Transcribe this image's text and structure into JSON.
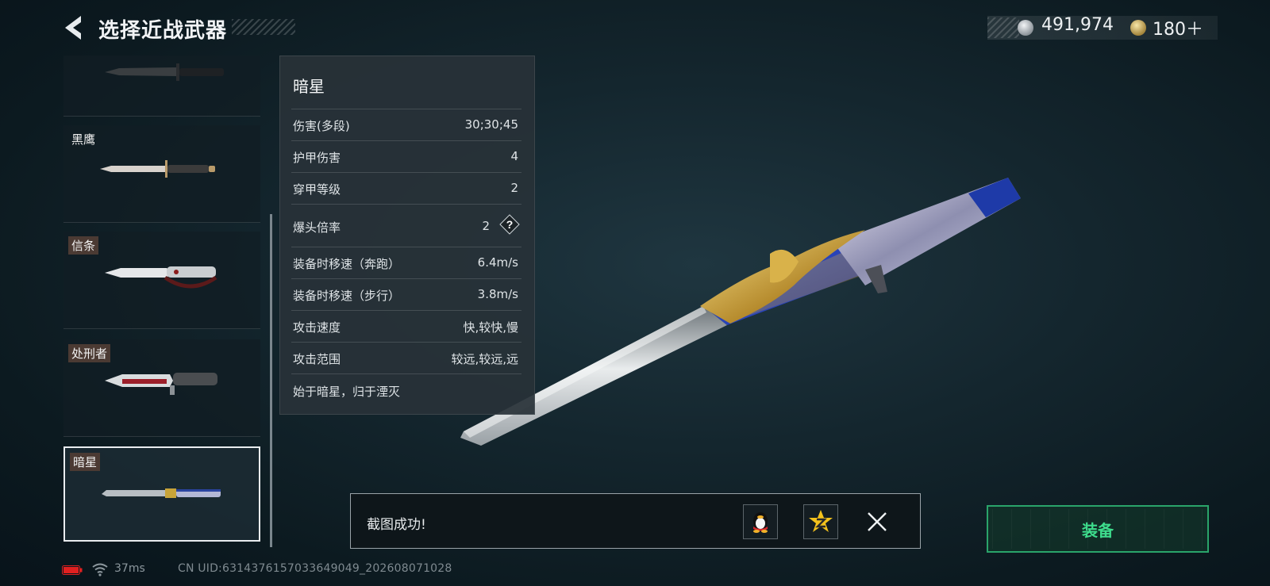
{
  "header": {
    "title": "选择近战武器"
  },
  "currency": {
    "silver": "491,974",
    "gold": "180＋"
  },
  "weapon_list": [
    {
      "label": ""
    },
    {
      "label": "黑鹰"
    },
    {
      "label": "信条"
    },
    {
      "label": "处刑者"
    },
    {
      "label": "暗星"
    }
  ],
  "stats": {
    "name": "暗星",
    "rows": [
      {
        "key": "伤害(多段)",
        "value": "30;30;45"
      },
      {
        "key": "护甲伤害",
        "value": "4"
      },
      {
        "key": "穿甲等级",
        "value": "2"
      },
      {
        "key": "爆头倍率",
        "value": "2"
      },
      {
        "key": "装备时移速（奔跑）",
        "value": "6.4m/s"
      },
      {
        "key": "装备时移速（步行）",
        "value": "3.8m/s"
      },
      {
        "key": "攻击速度",
        "value": "快,较快,慢"
      },
      {
        "key": "攻击范围",
        "value": "较远,较远,远"
      }
    ],
    "description": "始于暗星，归于湮灭",
    "help_glyph": "?"
  },
  "toast": {
    "text": "截图成功!"
  },
  "equip": {
    "label": "装备"
  },
  "status": {
    "latency": "37ms",
    "uid": "CN UID:6314376157033649049_202608071028"
  },
  "colors": {
    "accent_green": "#3ddc8c",
    "battery_red": "#e02020",
    "panel_bg": "#283238"
  }
}
